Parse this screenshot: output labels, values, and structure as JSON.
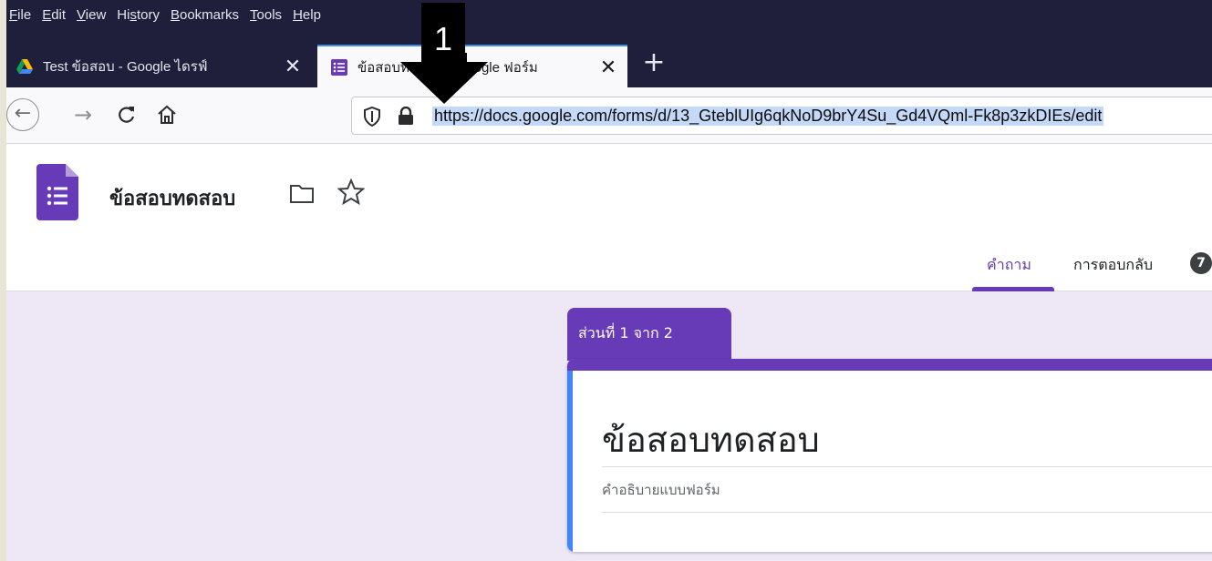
{
  "menu": {
    "items": [
      {
        "pre": "",
        "ul": "F",
        "post": "ile"
      },
      {
        "pre": "",
        "ul": "E",
        "post": "dit"
      },
      {
        "pre": "",
        "ul": "V",
        "post": "iew"
      },
      {
        "pre": "Hi",
        "ul": "s",
        "post": "tory"
      },
      {
        "pre": "",
        "ul": "B",
        "post": "ookmarks"
      },
      {
        "pre": "",
        "ul": "T",
        "post": "ools"
      },
      {
        "pre": "",
        "ul": "H",
        "post": "elp"
      }
    ]
  },
  "tabs": [
    {
      "title": "Test ข้อสอบ - Google ไดรฟ์",
      "icon": "google-drive-icon",
      "active": false
    },
    {
      "title": "ข้อสอบทดสอบ - Google ฟอร์ม",
      "icon": "google-forms-icon",
      "active": true
    }
  ],
  "tab_close_glyph": "✕",
  "new_tab_glyph": "+",
  "nav": {
    "url": "https://docs.google.com/forms/d/13_GteblUIg6qkNoD9brY4Su_Gd4VQml-Fk8p3zkDIEs/edit",
    "icons": [
      "back-icon",
      "forward-icon",
      "reload-icon",
      "home-icon",
      "tracking-shield-icon",
      "lock-icon"
    ]
  },
  "form_header": {
    "doc_title": "ข้อสอบทดสอบ",
    "tabs": {
      "questions": "คำถาม",
      "responses": "การตอบกลับ"
    },
    "response_count": "7"
  },
  "form": {
    "section_label": "ส่วนที่ 1 จาก 2",
    "title": "ข้อสอบทดสอบ",
    "description_placeholder": "คำอธิบายแบบฟอร์ม"
  },
  "annotation": {
    "number": "1"
  },
  "colors": {
    "browser_chrome": "#1f1e3b",
    "forms_purple": "#673ab7",
    "form_background": "#ede7f6",
    "accent_blue": "#4285f4"
  }
}
